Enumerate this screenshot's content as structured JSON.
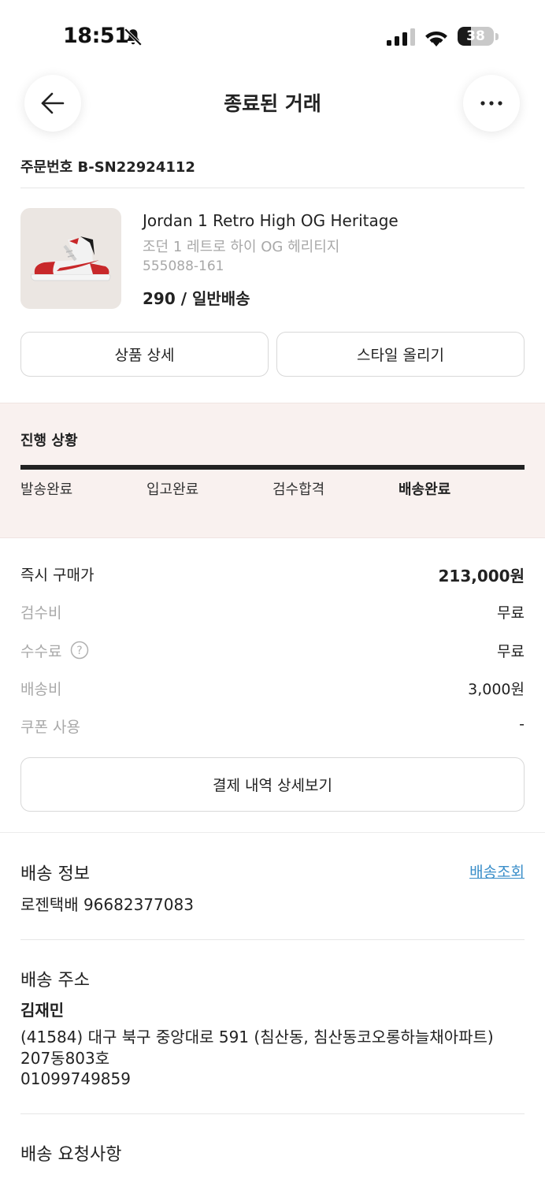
{
  "status_bar": {
    "time": "18:51",
    "battery": "38",
    "battery_level": 0.38
  },
  "header": {
    "title": "종료된 거래"
  },
  "order": {
    "number": "주문번호 B-SN22924112"
  },
  "product": {
    "name_en": "Jordan 1 Retro High OG Heritage",
    "name_ko": "조던 1 레트로 하이 OG 헤리티지",
    "code": "555088-161",
    "option": "290 / 일반배송"
  },
  "buttons": {
    "product_detail": "상품 상세",
    "upload_style": "스타일 올리기",
    "payment_detail": "결제 내역 상세보기"
  },
  "progress": {
    "title": "진행 상황",
    "fraction": 1.0,
    "steps": [
      "발송완료",
      "입고완료",
      "검수합격",
      "배송완료"
    ]
  },
  "payment": {
    "rows": [
      {
        "label": "즉시 구매가",
        "value": "213,000원"
      },
      {
        "label": "검수비",
        "value": "무료"
      },
      {
        "label": "수수료",
        "value": "무료"
      },
      {
        "label": "배송비",
        "value": "3,000원"
      },
      {
        "label": "쿠폰 사용",
        "value": "-"
      }
    ]
  },
  "shipping_info": {
    "heading": "배송 정보",
    "track_link": "배송조회",
    "courier": "로젠택배 96682377083"
  },
  "shipping_address": {
    "heading": "배송 주소",
    "name": "김재민",
    "address_line1": "(41584) 대구 북구 중앙대로 591 (침산동, 침산동코오롱하늘채아파트)",
    "address_line2": "207동803호",
    "phone": "01099749859"
  },
  "request": {
    "heading": "배송 요청사항"
  },
  "colors": {
    "accent_link": "#3a8ec9",
    "progress_bg": "#f9f1ef",
    "text": "#222222",
    "muted": "#a9a9a9"
  }
}
